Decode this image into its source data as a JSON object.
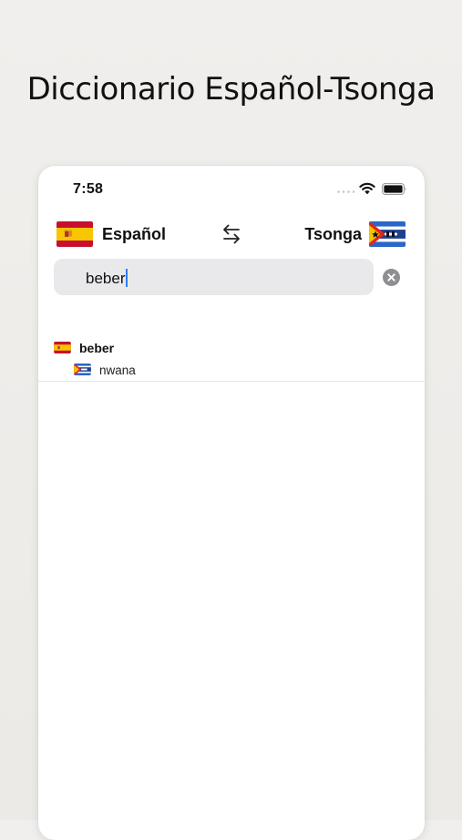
{
  "headline": "Diccionario Español-Tsonga",
  "status_bar": {
    "time": "7:58",
    "icons": [
      "signal-dots-icon",
      "wifi-icon",
      "battery-icon"
    ]
  },
  "language_bar": {
    "source": {
      "label": "Español",
      "flag": "spain-flag-icon"
    },
    "swap_icon": "swap-arrows-icon",
    "target": {
      "label": "Tsonga",
      "flag": "tsonga-flag-icon"
    }
  },
  "search": {
    "value": "beber",
    "clear_icon": "clear-circle-x-icon"
  },
  "results": [
    {
      "word": "beber",
      "translation": "nwana"
    }
  ],
  "colors": {
    "caret": "#2f7cf6",
    "search_background": "#e9e9eb",
    "clear_button": "#8e8e93"
  }
}
